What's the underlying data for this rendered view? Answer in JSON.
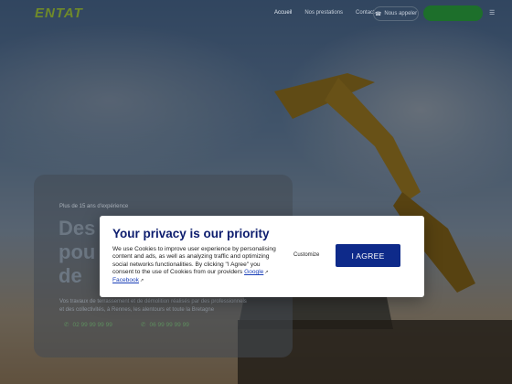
{
  "header": {
    "logo_text": "ENTAT",
    "nav": [
      "Accueil",
      "Nos prestations",
      "Contact"
    ],
    "contact_label": "Nous appeler",
    "quote_label": ""
  },
  "hero": {
    "eyebrow": "Plus de 15 ans d'expérience",
    "headline": "Des\npou\nde",
    "description_line1": "Vos travaux de terrassement et de démolition réalisés par des professionnels",
    "description_line2": "et des collectivités, à Rennes, les alentours et toute la Bretagne",
    "phone1": "02 99 99 99 99",
    "phone2": "06 99 99 99 99"
  },
  "cookie_modal": {
    "title": "Your privacy is our priority",
    "body_text": "We use Cookies to improve user experience by personalising content and ads, as well as analyzing traffic and optimizing social networks functionalities. By clicking \"I Agree\" you consent to the use of Cookies from our providers",
    "link_google": "Google",
    "link_facebook": "Facebook",
    "customize_label": "Customize",
    "agree_label": "I AGREE"
  },
  "colors": {
    "modal_title": "#0d1d6e",
    "agree_button": "#0e2a8a",
    "link": "#1a3fb8",
    "brand_green": "#1d6f2b"
  },
  "icons": [
    "phone-icon",
    "menu-icon",
    "external-link-icon",
    "excavator-illustration"
  ]
}
